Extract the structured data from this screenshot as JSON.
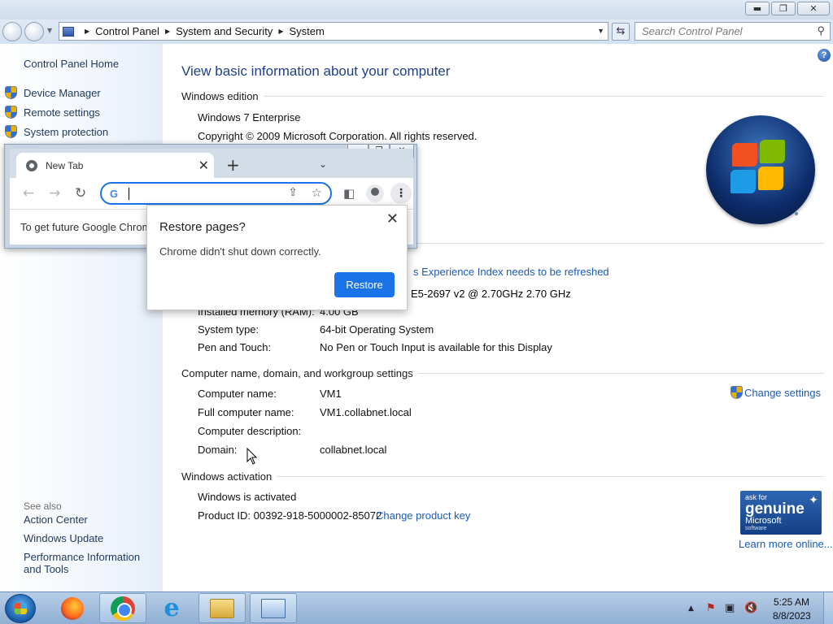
{
  "address_bar": {
    "crumbs": [
      "Control Panel",
      "System and Security",
      "System"
    ]
  },
  "search": {
    "placeholder": "Search Control Panel"
  },
  "left_pane": {
    "home": "Control Panel Home",
    "tasks": [
      "Device Manager",
      "Remote settings",
      "System protection"
    ],
    "see_also_label": "See also",
    "see_also": [
      "Action Center",
      "Windows Update",
      "Performance Information and Tools"
    ]
  },
  "main": {
    "title": "View basic information about your computer",
    "edition": {
      "heading": "Windows edition",
      "name": "Windows 7 Enterprise",
      "copyright": "Copyright © 2009 Microsoft Corporation.  All rights reserved."
    },
    "system": {
      "wei_link": "s Experience Index needs to be refreshed",
      "processor_value": "E5-2697 v2 @ 2.70GHz   2.70 GHz",
      "ram_label": "Installed memory (RAM):",
      "ram_value": "4.00 GB",
      "type_label": "System type:",
      "type_value": "64-bit Operating System",
      "pen_label": "Pen and Touch:",
      "pen_value": "No Pen or Touch Input is available for this Display"
    },
    "computer": {
      "heading": "Computer name, domain, and workgroup settings",
      "change_settings": "Change settings",
      "name_label": "Computer name:",
      "name_value": "VM1",
      "full_label": "Full computer name:",
      "full_value": "VM1.collabnet.local",
      "desc_label": "Computer description:",
      "desc_value": "",
      "domain_label": "Domain:",
      "domain_value": "collabnet.local"
    },
    "activation": {
      "heading": "Windows activation",
      "status": "Windows is activated",
      "product_id": "Product ID: 00392-918-5000002-85072",
      "change_key": "Change product key",
      "genuine_line1": "ask for",
      "genuine_line2": "genuine",
      "genuine_line3": "Microsoft",
      "genuine_line4": "software",
      "learn_more": "Learn more online..."
    }
  },
  "chrome": {
    "tab_title": "New Tab",
    "infobar": "To get future Google Chrom",
    "popup_title": "Restore pages?",
    "popup_message": "Chrome didn't shut down correctly.",
    "restore_label": "Restore"
  },
  "taskbar": {
    "time": "5:25 AM",
    "date": "8/8/2023"
  }
}
